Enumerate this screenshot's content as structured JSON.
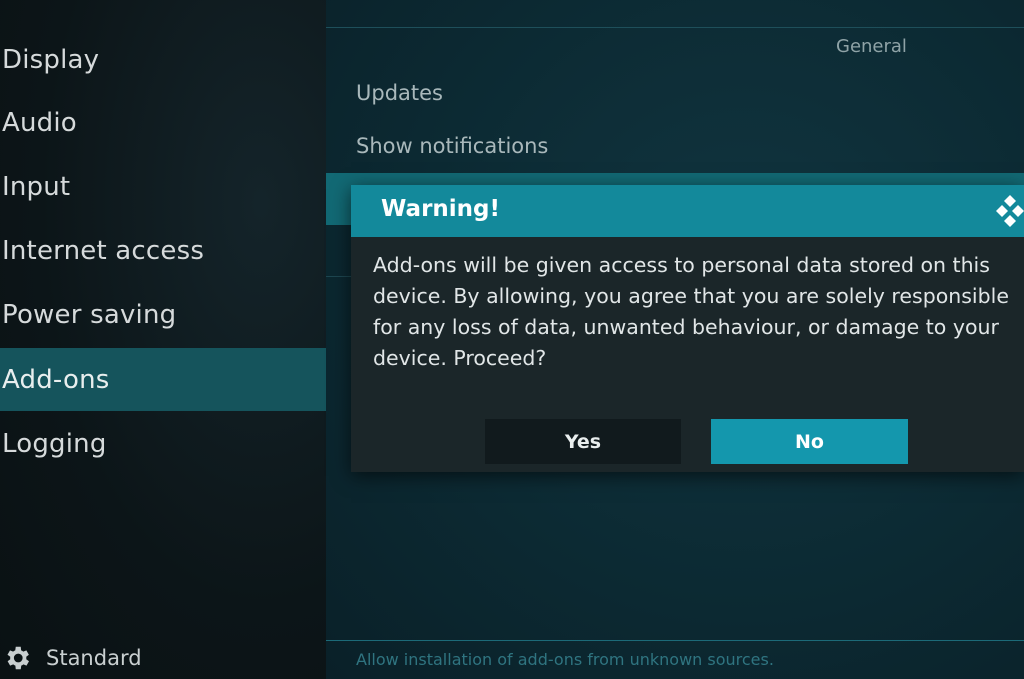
{
  "sidebar": {
    "items": [
      {
        "label": "Display"
      },
      {
        "label": "Audio"
      },
      {
        "label": "Input"
      },
      {
        "label": "Internet access"
      },
      {
        "label": "Power saving"
      },
      {
        "label": "Add-ons",
        "active": true
      },
      {
        "label": "Logging"
      }
    ],
    "settings_level": {
      "label": "Standard",
      "icon": "gear-icon"
    }
  },
  "content": {
    "category": "General",
    "settings": [
      {
        "label": "Updates"
      },
      {
        "label": "Show notifications"
      }
    ],
    "footer_hint": "Allow installation of add-ons from unknown sources."
  },
  "dialog": {
    "title": "Warning!",
    "logo_icon": "kodi-logo-icon",
    "message": "Add-ons will be given access to personal data stored on this device. By allowing, you agree that you are solely responsible for any loss of data, unwanted behaviour, or damage to your device. Proceed?",
    "buttons": {
      "yes": "Yes",
      "no": "No"
    }
  },
  "colors": {
    "accent": "#13899b",
    "active_sidebar": "#15545c",
    "focused_button": "#1497ad"
  }
}
